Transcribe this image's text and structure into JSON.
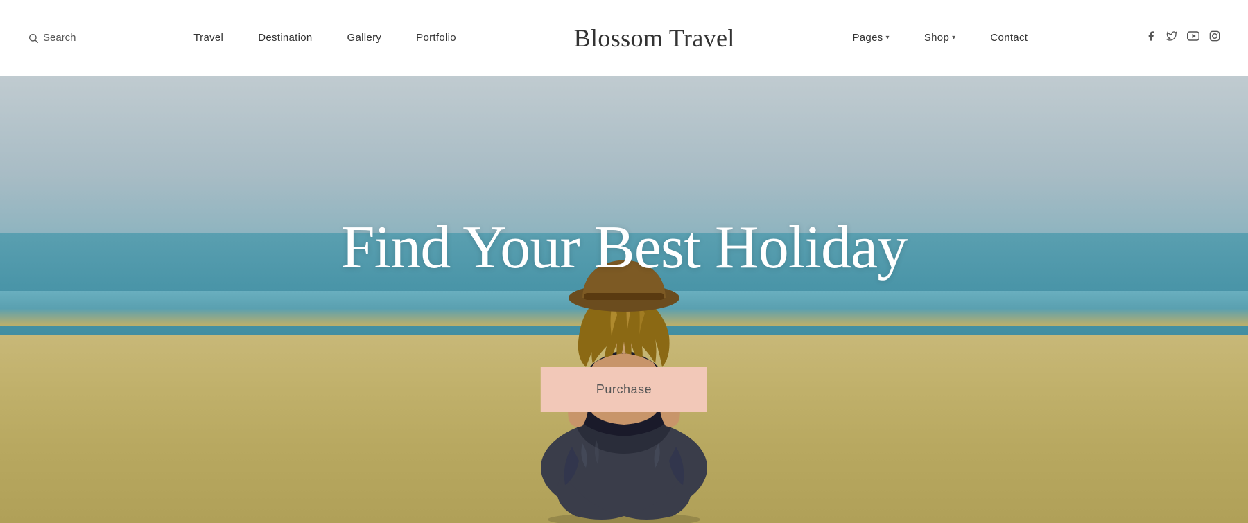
{
  "header": {
    "search_label": "Search",
    "logo": "Blossom Travel",
    "nav": [
      {
        "id": "travel",
        "label": "Travel",
        "has_dropdown": false
      },
      {
        "id": "destination",
        "label": "Destination",
        "has_dropdown": false
      },
      {
        "id": "gallery",
        "label": "Gallery",
        "has_dropdown": false
      },
      {
        "id": "portfolio",
        "label": "Portfolio",
        "has_dropdown": false
      }
    ],
    "nav_right": [
      {
        "id": "pages",
        "label": "Pages",
        "has_dropdown": true
      },
      {
        "id": "shop",
        "label": "Shop",
        "has_dropdown": true
      },
      {
        "id": "contact",
        "label": "Contact",
        "has_dropdown": false
      }
    ],
    "social": [
      {
        "id": "facebook",
        "icon": "f",
        "label": "Facebook"
      },
      {
        "id": "twitter",
        "icon": "t",
        "label": "Twitter"
      },
      {
        "id": "youtube",
        "icon": "▶",
        "label": "YouTube"
      },
      {
        "id": "instagram",
        "icon": "◻",
        "label": "Instagram"
      }
    ]
  },
  "hero": {
    "title": "Find Your Best Holiday",
    "purchase_button": "Purchase"
  }
}
